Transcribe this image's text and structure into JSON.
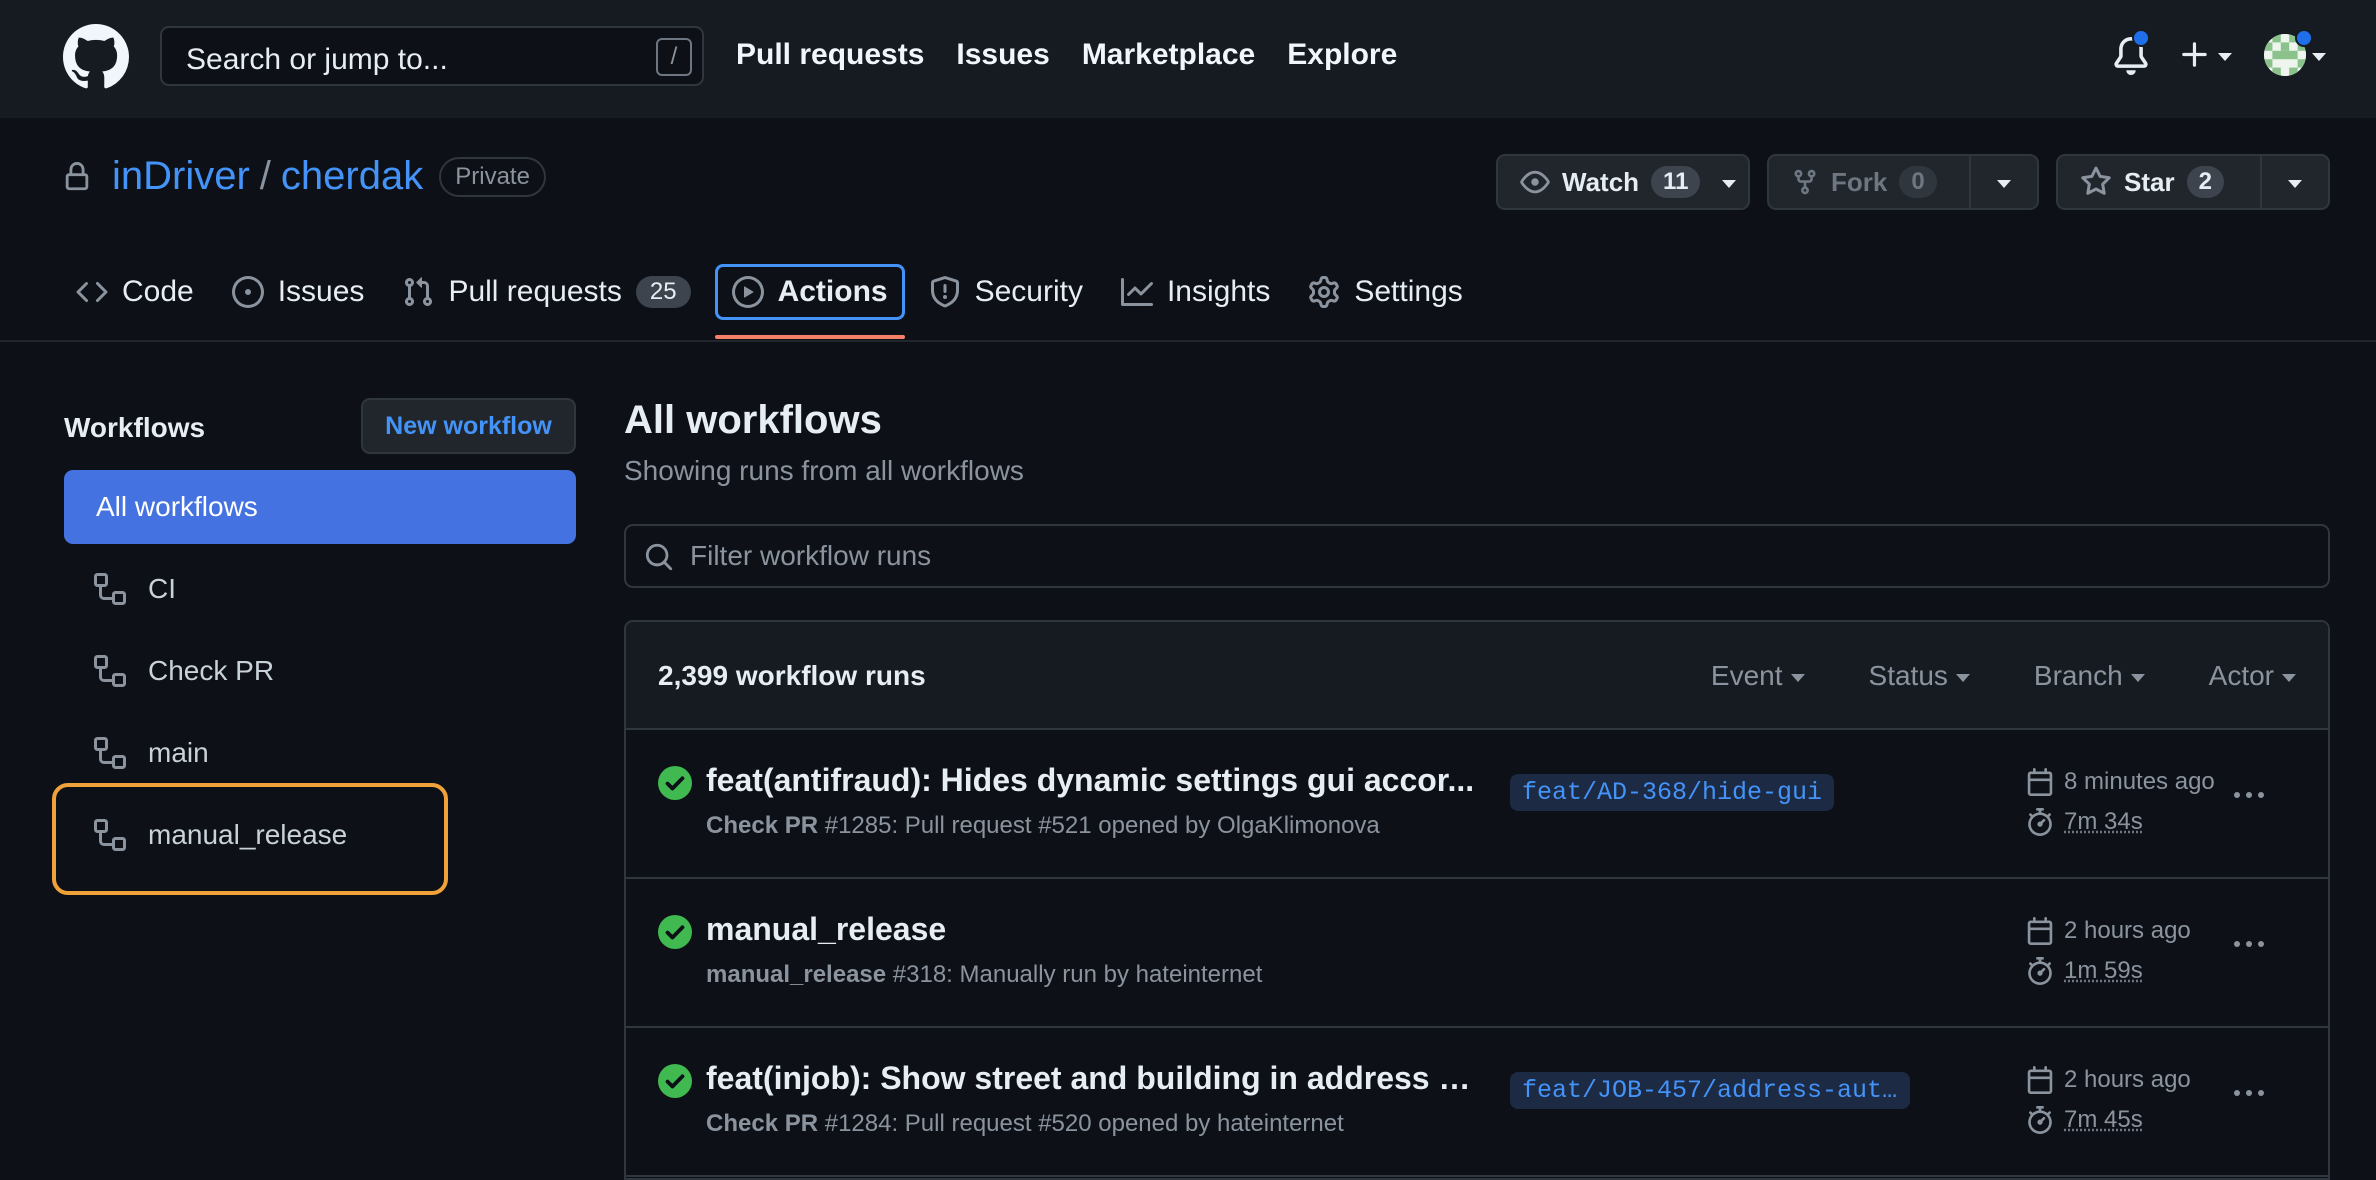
{
  "header": {
    "search_placeholder": "Search or jump to...",
    "search_shortcut": "/",
    "nav": [
      "Pull requests",
      "Issues",
      "Marketplace",
      "Explore"
    ]
  },
  "repo": {
    "owner": "inDriver",
    "separator": "/",
    "name": "cherdak",
    "visibility": "Private",
    "watch_label": "Watch",
    "watch_count": "11",
    "fork_label": "Fork",
    "fork_count": "0",
    "star_label": "Star",
    "star_count": "2"
  },
  "tabs": {
    "code": "Code",
    "issues": "Issues",
    "pull_requests": "Pull requests",
    "pull_requests_count": "25",
    "actions": "Actions",
    "security": "Security",
    "insights": "Insights",
    "settings": "Settings"
  },
  "sidebar": {
    "heading": "Workflows",
    "new_workflow": "New workflow",
    "all_workflows": "All workflows",
    "items": [
      "CI",
      "Check PR",
      "main",
      "manual_release"
    ]
  },
  "main": {
    "title": "All workflows",
    "subtitle": "Showing runs from all workflows",
    "filter_placeholder": "Filter workflow runs",
    "runs_count": "2,399 workflow runs",
    "filters": [
      "Event",
      "Status",
      "Branch",
      "Actor"
    ],
    "runs": [
      {
        "title": "feat(antifraud): Hides dynamic settings gui accor...",
        "workflow": "Check PR",
        "meta": " #1285: Pull request #521 opened by OlgaKlimonova",
        "branch": "feat/AD-368/hide-gui",
        "when": "8 minutes ago",
        "duration": "7m 34s"
      },
      {
        "title": "manual_release",
        "workflow": "manual_release",
        "meta": " #318: Manually run by hateinternet",
        "branch": "",
        "when": "2 hours ago",
        "duration": "1m 59s"
      },
      {
        "title": "feat(injob): Show street and building in address s...",
        "workflow": "Check PR",
        "meta": " #1284: Pull request #520 opened by hateinternet",
        "branch": "feat/JOB-457/address-auto…",
        "when": "2 hours ago",
        "duration": "7m 45s"
      }
    ]
  },
  "colors": {
    "accent": "#4493f8",
    "selected_bg": "#4472e0",
    "success": "#3fb950",
    "highlight": "#f0a23a",
    "active_tab_underline": "#f78166"
  }
}
